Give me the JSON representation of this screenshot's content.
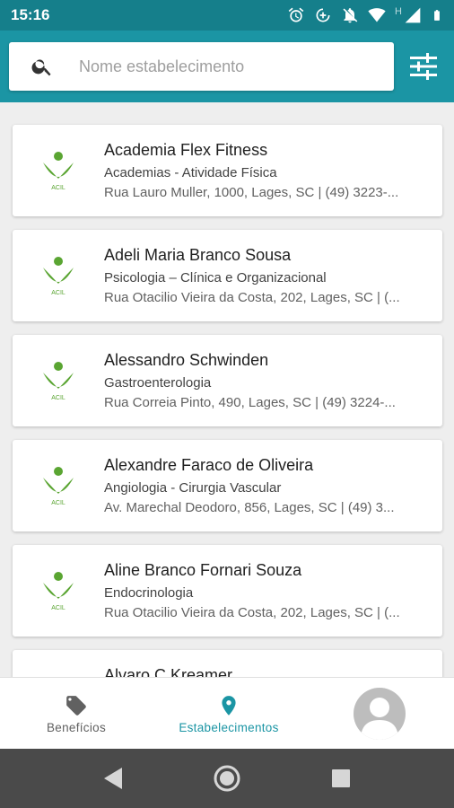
{
  "status_bar": {
    "time": "15:16",
    "icons": [
      "alarm-icon",
      "data-saver-icon",
      "notifications-off-icon",
      "wifi-icon",
      "signal-icon",
      "battery-icon"
    ],
    "network_letter": "H"
  },
  "colors": {
    "accent": "#1b95a4",
    "status_bar": "#157f8b",
    "logo_green": "#5aa532",
    "system_nav": "#4a4a4a"
  },
  "search": {
    "placeholder": "Nome estabelecimento",
    "value": "",
    "icon": "search-icon",
    "filter_icon": "tune-icon"
  },
  "establishments": [
    {
      "name": "Academia Flex Fitness",
      "category": "Academias - Atividade Física",
      "address": "Rua Lauro Muller, 1000, Lages, SC | (49) 3223-..."
    },
    {
      "name": "Adeli Maria Branco Sousa",
      "category": "Psicologia – Clínica e Organizacional",
      "address": "Rua Otacilio Vieira da Costa, 202, Lages, SC | (..."
    },
    {
      "name": "Alessandro Schwinden",
      "category": "Gastroenterologia",
      "address": "Rua Correia Pinto, 490, Lages, SC | (49) 3224-..."
    },
    {
      "name": "Alexandre Faraco de Oliveira",
      "category": "Angiologia - Cirurgia Vascular",
      "address": "Av. Marechal Deodoro, 856, Lages, SC | (49) 3..."
    },
    {
      "name": "Aline Branco Fornari Souza",
      "category": "Endocrinologia",
      "address": "Rua Otacilio Vieira da Costa, 202, Lages, SC | (..."
    },
    {
      "name": "Alvaro C Kreamer",
      "category": "",
      "address": ""
    }
  ],
  "logo": {
    "text": "ACIL"
  },
  "bottom_nav": {
    "items": [
      {
        "label": "Benefícios",
        "icon": "tag-icon",
        "active": false
      },
      {
        "label": "Estabelecimentos",
        "icon": "location-pin-icon",
        "active": true
      }
    ],
    "profile_icon": "avatar-icon"
  },
  "system_nav": [
    "back-icon",
    "home-icon",
    "recents-icon"
  ]
}
